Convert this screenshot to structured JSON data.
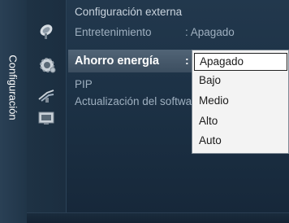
{
  "sidebar": {
    "label": "Configuración"
  },
  "icons": [
    "satellite-dish-icon",
    "gear-icon",
    "antenna-icon",
    "input-source-icon"
  ],
  "menu": {
    "items": [
      {
        "label": "Configuración externa"
      },
      {
        "label": "Entretenimiento",
        "value": ": Apagado"
      },
      {
        "label": "Ahorro energía",
        "value": ":"
      },
      {
        "label": "PIP"
      },
      {
        "label": "Actualización del software"
      }
    ],
    "selected_index": 2
  },
  "dropdown": {
    "options": [
      "Apagado",
      "Bajo",
      "Medio",
      "Alto",
      "Auto"
    ],
    "selected": "Apagado"
  },
  "colors": {
    "highlight": "#516476",
    "dropdown_bg": "#f3f3f3"
  }
}
